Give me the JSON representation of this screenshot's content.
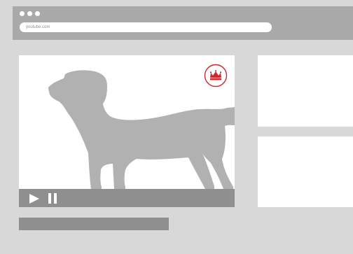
{
  "browser": {
    "url": "youtube.com"
  },
  "video": {
    "brand_icon": "crown-badge-icon",
    "subject_icon": "dog-silhouette-icon",
    "controls": {
      "play_icon": "play-icon",
      "pause_icon": "pause-icon"
    }
  },
  "colors": {
    "page_background": "#d8d8d8",
    "chrome": "#a9a9a9",
    "panel": "#ffffff",
    "control_bar": "#8f8f8f",
    "dog_silhouette": "#b1b1b1",
    "brand_accent": "#d1262c"
  }
}
